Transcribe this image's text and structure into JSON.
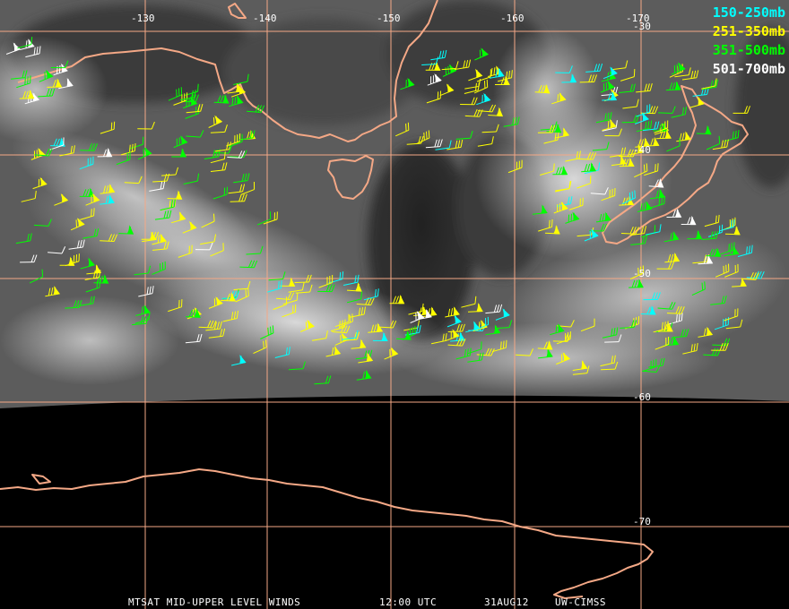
{
  "map": {
    "lon_labels": [
      "-130",
      "-140",
      "-150",
      "-160",
      "-170"
    ],
    "lat_labels": [
      "-30",
      "-40",
      "-50",
      "-60",
      "-70"
    ]
  },
  "legend": [
    {
      "label": "150-250mb",
      "color": "#00ffff"
    },
    {
      "label": "251-350mb",
      "color": "#ffff00"
    },
    {
      "label": "351-500mb",
      "color": "#00ff00"
    },
    {
      "label": "501-700mb",
      "color": "#ffffff"
    }
  ],
  "footer": {
    "product": "MTSAT MID-UPPER LEVEL WINDS",
    "time": "12:00 UTC",
    "date": "31AUG12",
    "source": "UW-CIMSS"
  },
  "colors": {
    "coast": "#f4a886",
    "grid": "#f4a886"
  }
}
